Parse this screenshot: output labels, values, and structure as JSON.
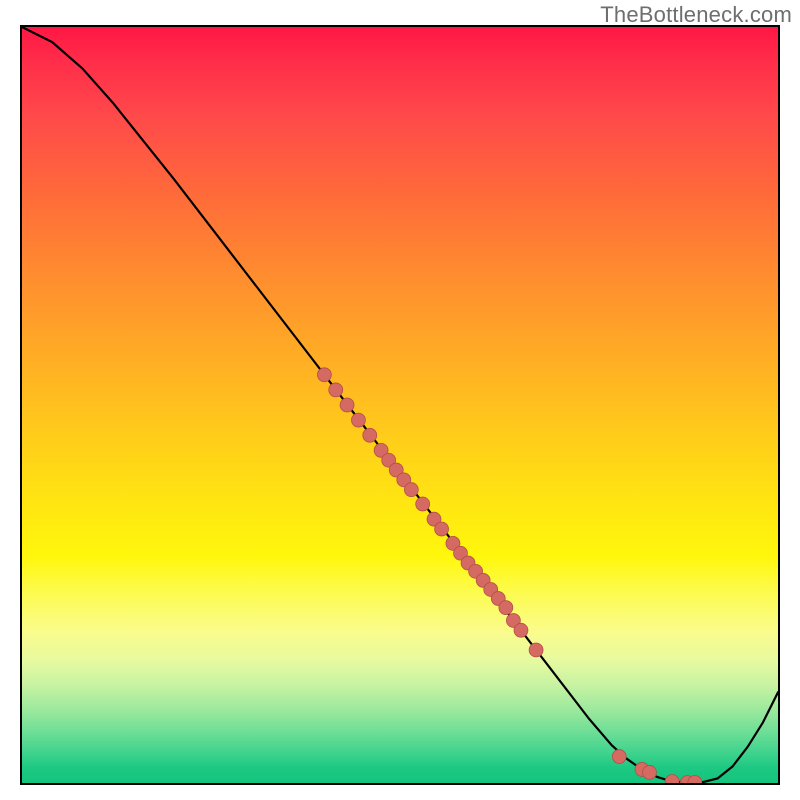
{
  "watermark": "TheBottleneck.com",
  "colors": {
    "curve": "#000000",
    "dot_fill": "#d46a62",
    "dot_stroke": "#b34f47"
  },
  "chart_data": {
    "type": "line",
    "title": "",
    "xlabel": "",
    "ylabel": "",
    "xlim": [
      0,
      100
    ],
    "ylim": [
      0,
      100
    ],
    "grid": false,
    "legend": false,
    "series": [
      {
        "name": "bottleneck-curve",
        "x": [
          0,
          4,
          8,
          12,
          16,
          20,
          25,
          30,
          35,
          40,
          45,
          50,
          55,
          60,
          65,
          70,
          75,
          78,
          80,
          82,
          84,
          86,
          88,
          90,
          92,
          94,
          96,
          98,
          100
        ],
        "y": [
          100,
          98,
          94.5,
          90,
          85,
          80,
          73.5,
          67,
          60.5,
          54,
          47.5,
          41,
          34.5,
          28,
          21.5,
          15,
          8.5,
          5,
          3.2,
          1.8,
          0.8,
          0.2,
          0.05,
          0.1,
          0.6,
          2.2,
          4.8,
          8,
          12
        ]
      }
    ],
    "scatter_on_curve": {
      "name": "highlighted-points",
      "x": [
        40,
        41.5,
        43,
        44.5,
        46,
        47.5,
        48.5,
        49.5,
        50.5,
        51.5,
        53,
        54.5,
        55.5,
        57,
        58,
        59,
        60,
        61,
        62,
        63,
        64,
        65,
        66,
        68,
        79,
        82,
        83,
        86,
        88,
        89
      ],
      "y": [
        54,
        52,
        50,
        48,
        46,
        44,
        42.7,
        41.4,
        40.1,
        38.8,
        36.9,
        34.9,
        33.6,
        31.7,
        30.4,
        29.1,
        28,
        26.8,
        25.6,
        24.4,
        23.2,
        21.5,
        20.2,
        17.6,
        3.5,
        1.8,
        1.4,
        0.2,
        0.05,
        0.07
      ]
    }
  }
}
